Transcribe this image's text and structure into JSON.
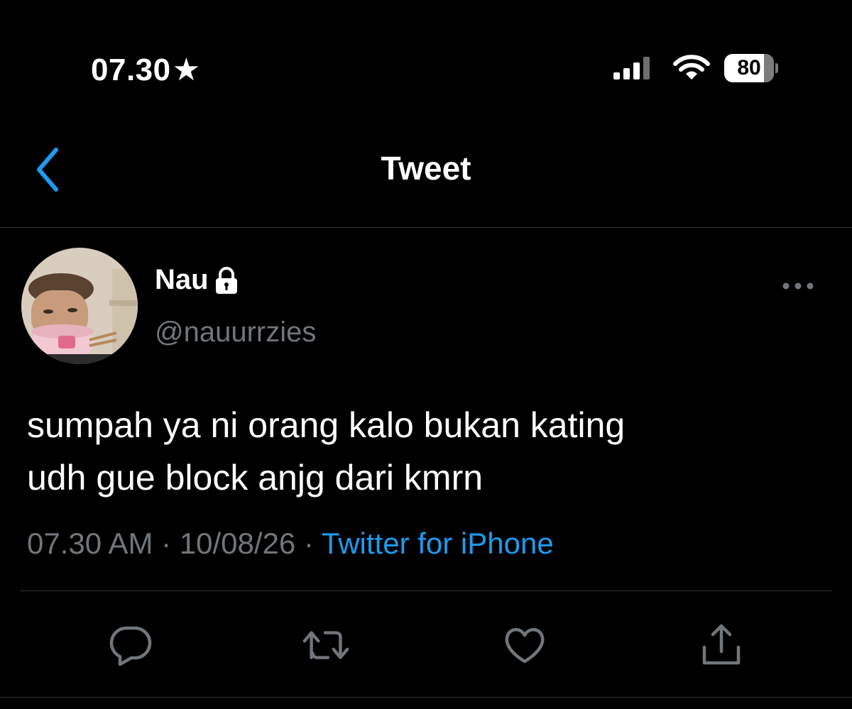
{
  "status_bar": {
    "time": "07.30",
    "star_glyph": "★",
    "signal_icon": "cellular-signal-icon",
    "wifi_icon": "wifi-icon",
    "battery_level": 80,
    "battery_label": "80"
  },
  "nav": {
    "back_icon": "chevron-left-icon",
    "title": "Tweet"
  },
  "tweet": {
    "author_name": "Nau",
    "protected_icon": "lock-icon",
    "handle": "@nauurrzies",
    "more_icon": "more-horizontal-icon",
    "text_line1": "sumpah ya ni orang kalo bukan kating",
    "text_line2": "udh gue block anjg dari kmrn",
    "time": "07.30 AM",
    "separator": " · ",
    "date": "10/08/26",
    "source": "Twitter for iPhone"
  },
  "actions": [
    {
      "icon": "reply-icon"
    },
    {
      "icon": "retweet-icon"
    },
    {
      "icon": "like-icon"
    },
    {
      "icon": "share-icon"
    }
  ],
  "colors": {
    "background": "#000000",
    "text_primary": "#ffffff",
    "text_secondary": "#71767b",
    "accent": "#1d9bf0",
    "divider": "#2f3336"
  }
}
